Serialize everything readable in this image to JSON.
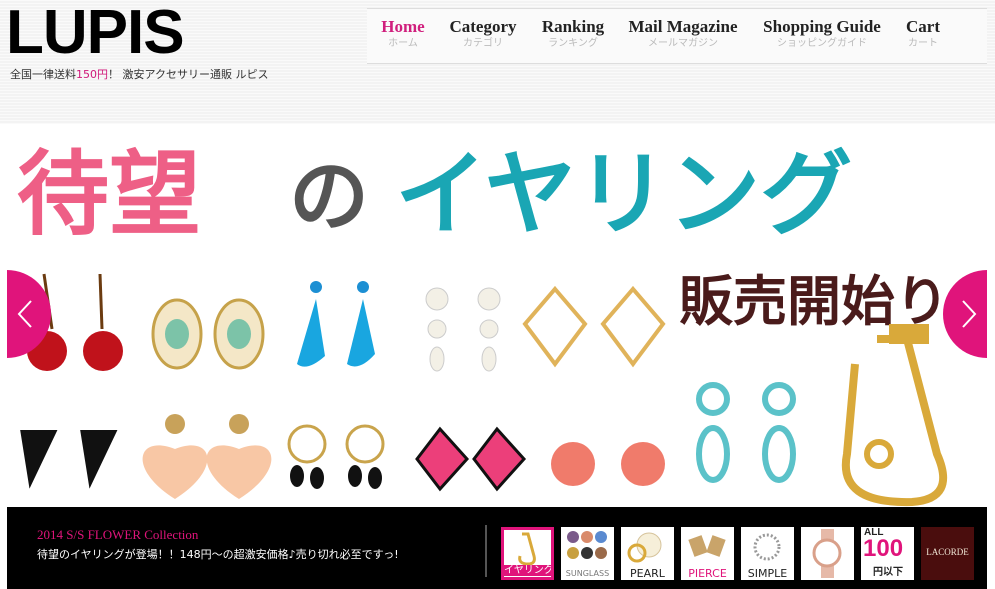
{
  "brand": {
    "logo": "LUPIS",
    "tagline_pre": "全国一律送料",
    "tagline_price": "150円",
    "tagline_post": "！ 激安アクセサリー通販 ルピス"
  },
  "nav": [
    {
      "en": "Home",
      "jp": "ホーム",
      "active": true
    },
    {
      "en": "Category",
      "jp": "カテゴリ"
    },
    {
      "en": "Ranking",
      "jp": "ランキング"
    },
    {
      "en": "Mail Magazine",
      "jp": "メールマガジン"
    },
    {
      "en": "Shopping Guide",
      "jp": "ショッピングガイド"
    },
    {
      "en": "Cart",
      "jp": "カート"
    }
  ],
  "hero": {
    "headline_a": "待望",
    "headline_b": "の",
    "headline_c": "イヤリング",
    "sub": "販売開始り"
  },
  "caption": {
    "title": "2014 S/S FLOWER Collection",
    "text": "待望のイヤリングが登場！！148円〜の超激安価格♪売り切れ必至ですっ!"
  },
  "thumbs": [
    {
      "label": "イヤリング",
      "active": true
    },
    {
      "label": "SUNGLASS"
    },
    {
      "label": "PEARL"
    },
    {
      "label": "PIERCE"
    },
    {
      "label": "SIMPLE"
    },
    {
      "label": ""
    },
    {
      "label_top": "ALL",
      "label_big": "100",
      "label_bottom": "円以下"
    },
    {
      "label": "LACORDE"
    }
  ],
  "colors": {
    "accent": "#e0147b",
    "teal": "#1aa6b4",
    "pink": "#ee5f86",
    "gray": "#555555"
  },
  "icons": {
    "prev": "chevron-left-icon",
    "next": "chevron-right-icon"
  }
}
